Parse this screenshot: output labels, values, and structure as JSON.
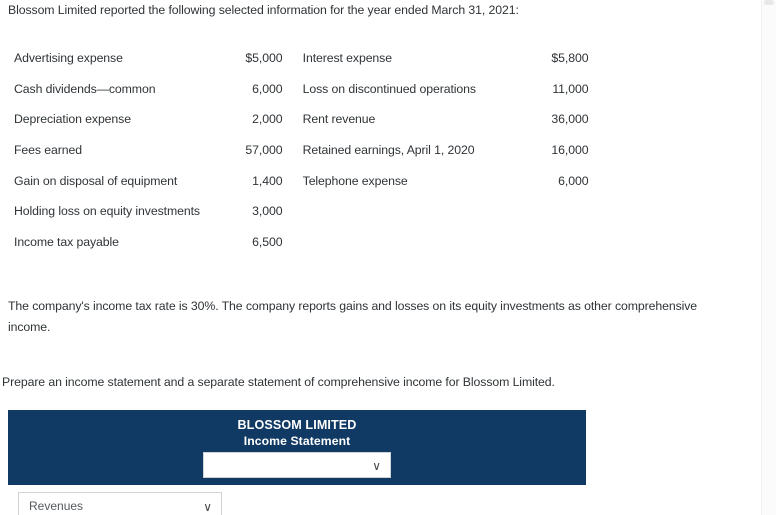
{
  "intro": {
    "text": "Blossom Limited reported the following selected information for the year ended March 31, 2021:"
  },
  "table": {
    "rows": [
      {
        "label_a": "Advertising expense",
        "amount_a": "$5,000",
        "label_b": "Interest expense",
        "amount_b": "$5,800"
      },
      {
        "label_a": "Cash dividends—common",
        "amount_a": "6,000",
        "label_b": "Loss on discontinued operations",
        "amount_b": "11,000"
      },
      {
        "label_a": "Depreciation expense",
        "amount_a": "2,000",
        "label_b": "Rent revenue",
        "amount_b": "36,000"
      },
      {
        "label_a": "Fees earned",
        "amount_a": "57,000",
        "label_b": "Retained earnings, April 1, 2020",
        "amount_b": "16,000"
      },
      {
        "label_a": "Gain on disposal of equipment",
        "amount_a": "1,400",
        "label_b": "Telephone expense",
        "amount_b": "6,000"
      },
      {
        "label_a": "Holding loss on equity investments",
        "amount_a": "3,000",
        "label_b": "",
        "amount_b": ""
      },
      {
        "label_a": "Income tax payable",
        "amount_a": "6,500",
        "label_b": "",
        "amount_b": ""
      }
    ]
  },
  "tax_note": {
    "text": "The company's income tax rate is 30%. The company reports gains and losses on its equity investments as other comprehensive income."
  },
  "instruction": {
    "text": "Prepare an income statement and a separate statement of comprehensive income for Blossom Limited."
  },
  "statement_panel": {
    "company": "BLOSSOM LIMITED",
    "title": "Income Statement",
    "period_select_value": "",
    "period_select_placeholder": "",
    "chevron": "∨",
    "accent_color": "#103a63"
  },
  "section_select": {
    "value": "Revenues",
    "chevron": "∨"
  }
}
